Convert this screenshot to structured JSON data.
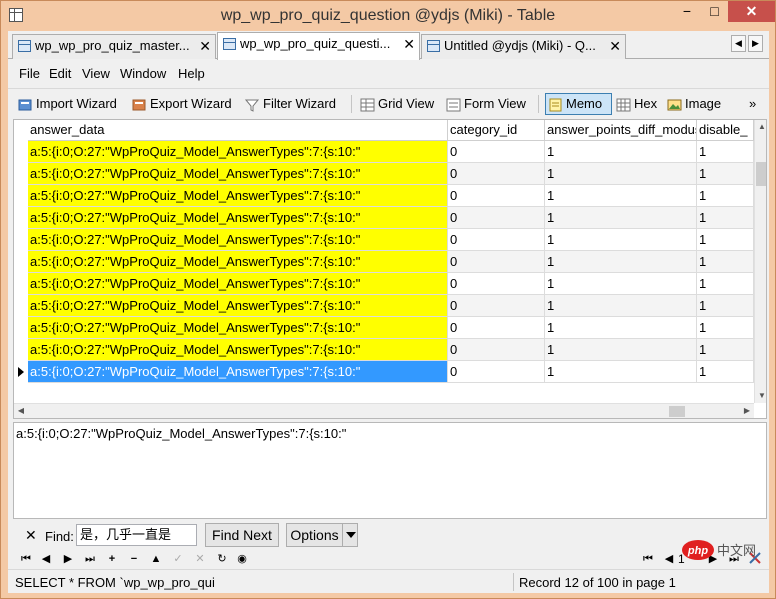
{
  "window": {
    "title": "wp_wp_pro_quiz_question @ydjs (Miki) - Table",
    "minimize": "−",
    "maximize": "□",
    "close": "✕"
  },
  "tabs": [
    {
      "label": "wp_wp_pro_quiz_master...",
      "close": "✕",
      "active": false
    },
    {
      "label": "wp_wp_pro_quiz_questi...",
      "close": "✕",
      "active": true
    },
    {
      "label": "Untitled @ydjs (Miki) - Q...",
      "close": "✕",
      "active": false
    }
  ],
  "tab_scroll": {
    "left": "◀",
    "right": "▶"
  },
  "menu": [
    "File",
    "Edit",
    "View",
    "Window",
    "Help"
  ],
  "toolbar": {
    "import_wizard": "Import Wizard",
    "export_wizard": "Export Wizard",
    "filter_wizard": "Filter Wizard",
    "grid_view": "Grid View",
    "form_view": "Form View",
    "memo": "Memo",
    "hex": "Hex",
    "image": "Image",
    "more": "»"
  },
  "grid": {
    "columns": [
      "answer_data",
      "category_id",
      "answer_points_diff_modus",
      "disable_"
    ],
    "rows": [
      [
        "a:5:{i:0;O:27:\"WpProQuiz_Model_AnswerTypes\":7:{s:10:\"",
        "0",
        "1",
        "1"
      ],
      [
        "a:5:{i:0;O:27:\"WpProQuiz_Model_AnswerTypes\":7:{s:10:\"",
        "0",
        "1",
        "1"
      ],
      [
        "a:5:{i:0;O:27:\"WpProQuiz_Model_AnswerTypes\":7:{s:10:\"",
        "0",
        "1",
        "1"
      ],
      [
        "a:5:{i:0;O:27:\"WpProQuiz_Model_AnswerTypes\":7:{s:10:\"",
        "0",
        "1",
        "1"
      ],
      [
        "a:5:{i:0;O:27:\"WpProQuiz_Model_AnswerTypes\":7:{s:10:\"",
        "0",
        "1",
        "1"
      ],
      [
        "a:5:{i:0;O:27:\"WpProQuiz_Model_AnswerTypes\":7:{s:10:\"",
        "0",
        "1",
        "1"
      ],
      [
        "a:5:{i:0;O:27:\"WpProQuiz_Model_AnswerTypes\":7:{s:10:\"",
        "0",
        "1",
        "1"
      ],
      [
        "a:5:{i:0;O:27:\"WpProQuiz_Model_AnswerTypes\":7:{s:10:\"",
        "0",
        "1",
        "1"
      ],
      [
        "a:5:{i:0;O:27:\"WpProQuiz_Model_AnswerTypes\":7:{s:10:\"",
        "0",
        "1",
        "1"
      ],
      [
        "a:5:{i:0;O:27:\"WpProQuiz_Model_AnswerTypes\":7:{s:10:\"",
        "0",
        "1",
        "1"
      ],
      [
        "a:5:{i:0;O:27:\"WpProQuiz_Model_AnswerTypes\":7:{s:10:\"",
        "0",
        "1",
        "1"
      ]
    ],
    "selected_row": 10
  },
  "memo_editor": {
    "value": "a:5:{i:0;O:27:\"WpProQuiz_Model_AnswerTypes\":7:{s:10:\""
  },
  "find": {
    "close": "✕",
    "label": "Find:",
    "value": "是，几乎一直是",
    "find_next": "Find Next",
    "options": "Options"
  },
  "nav": {
    "first": "⏮",
    "prev": "◀",
    "next": "▶",
    "last": "⏭",
    "add": "+",
    "delete": "−",
    "up": "▲",
    "apply": "✓",
    "cancel": "✕",
    "refresh": "↻",
    "stop": "◉",
    "page_first": "⏮",
    "page_prev": "◀",
    "page": "1",
    "page_next": "▶",
    "page_last": "⏭"
  },
  "status": {
    "sql": "SELECT * FROM `wp_wp_pro_quiz_",
    "record": "Record 12 of 100 in page 1",
    "watermark": "php 中文网"
  },
  "colors": {
    "memo_highlight": "#ffff00",
    "selection": "#3399ff",
    "title_bar": "#f4c9a5",
    "close_button": "#c7504b"
  }
}
